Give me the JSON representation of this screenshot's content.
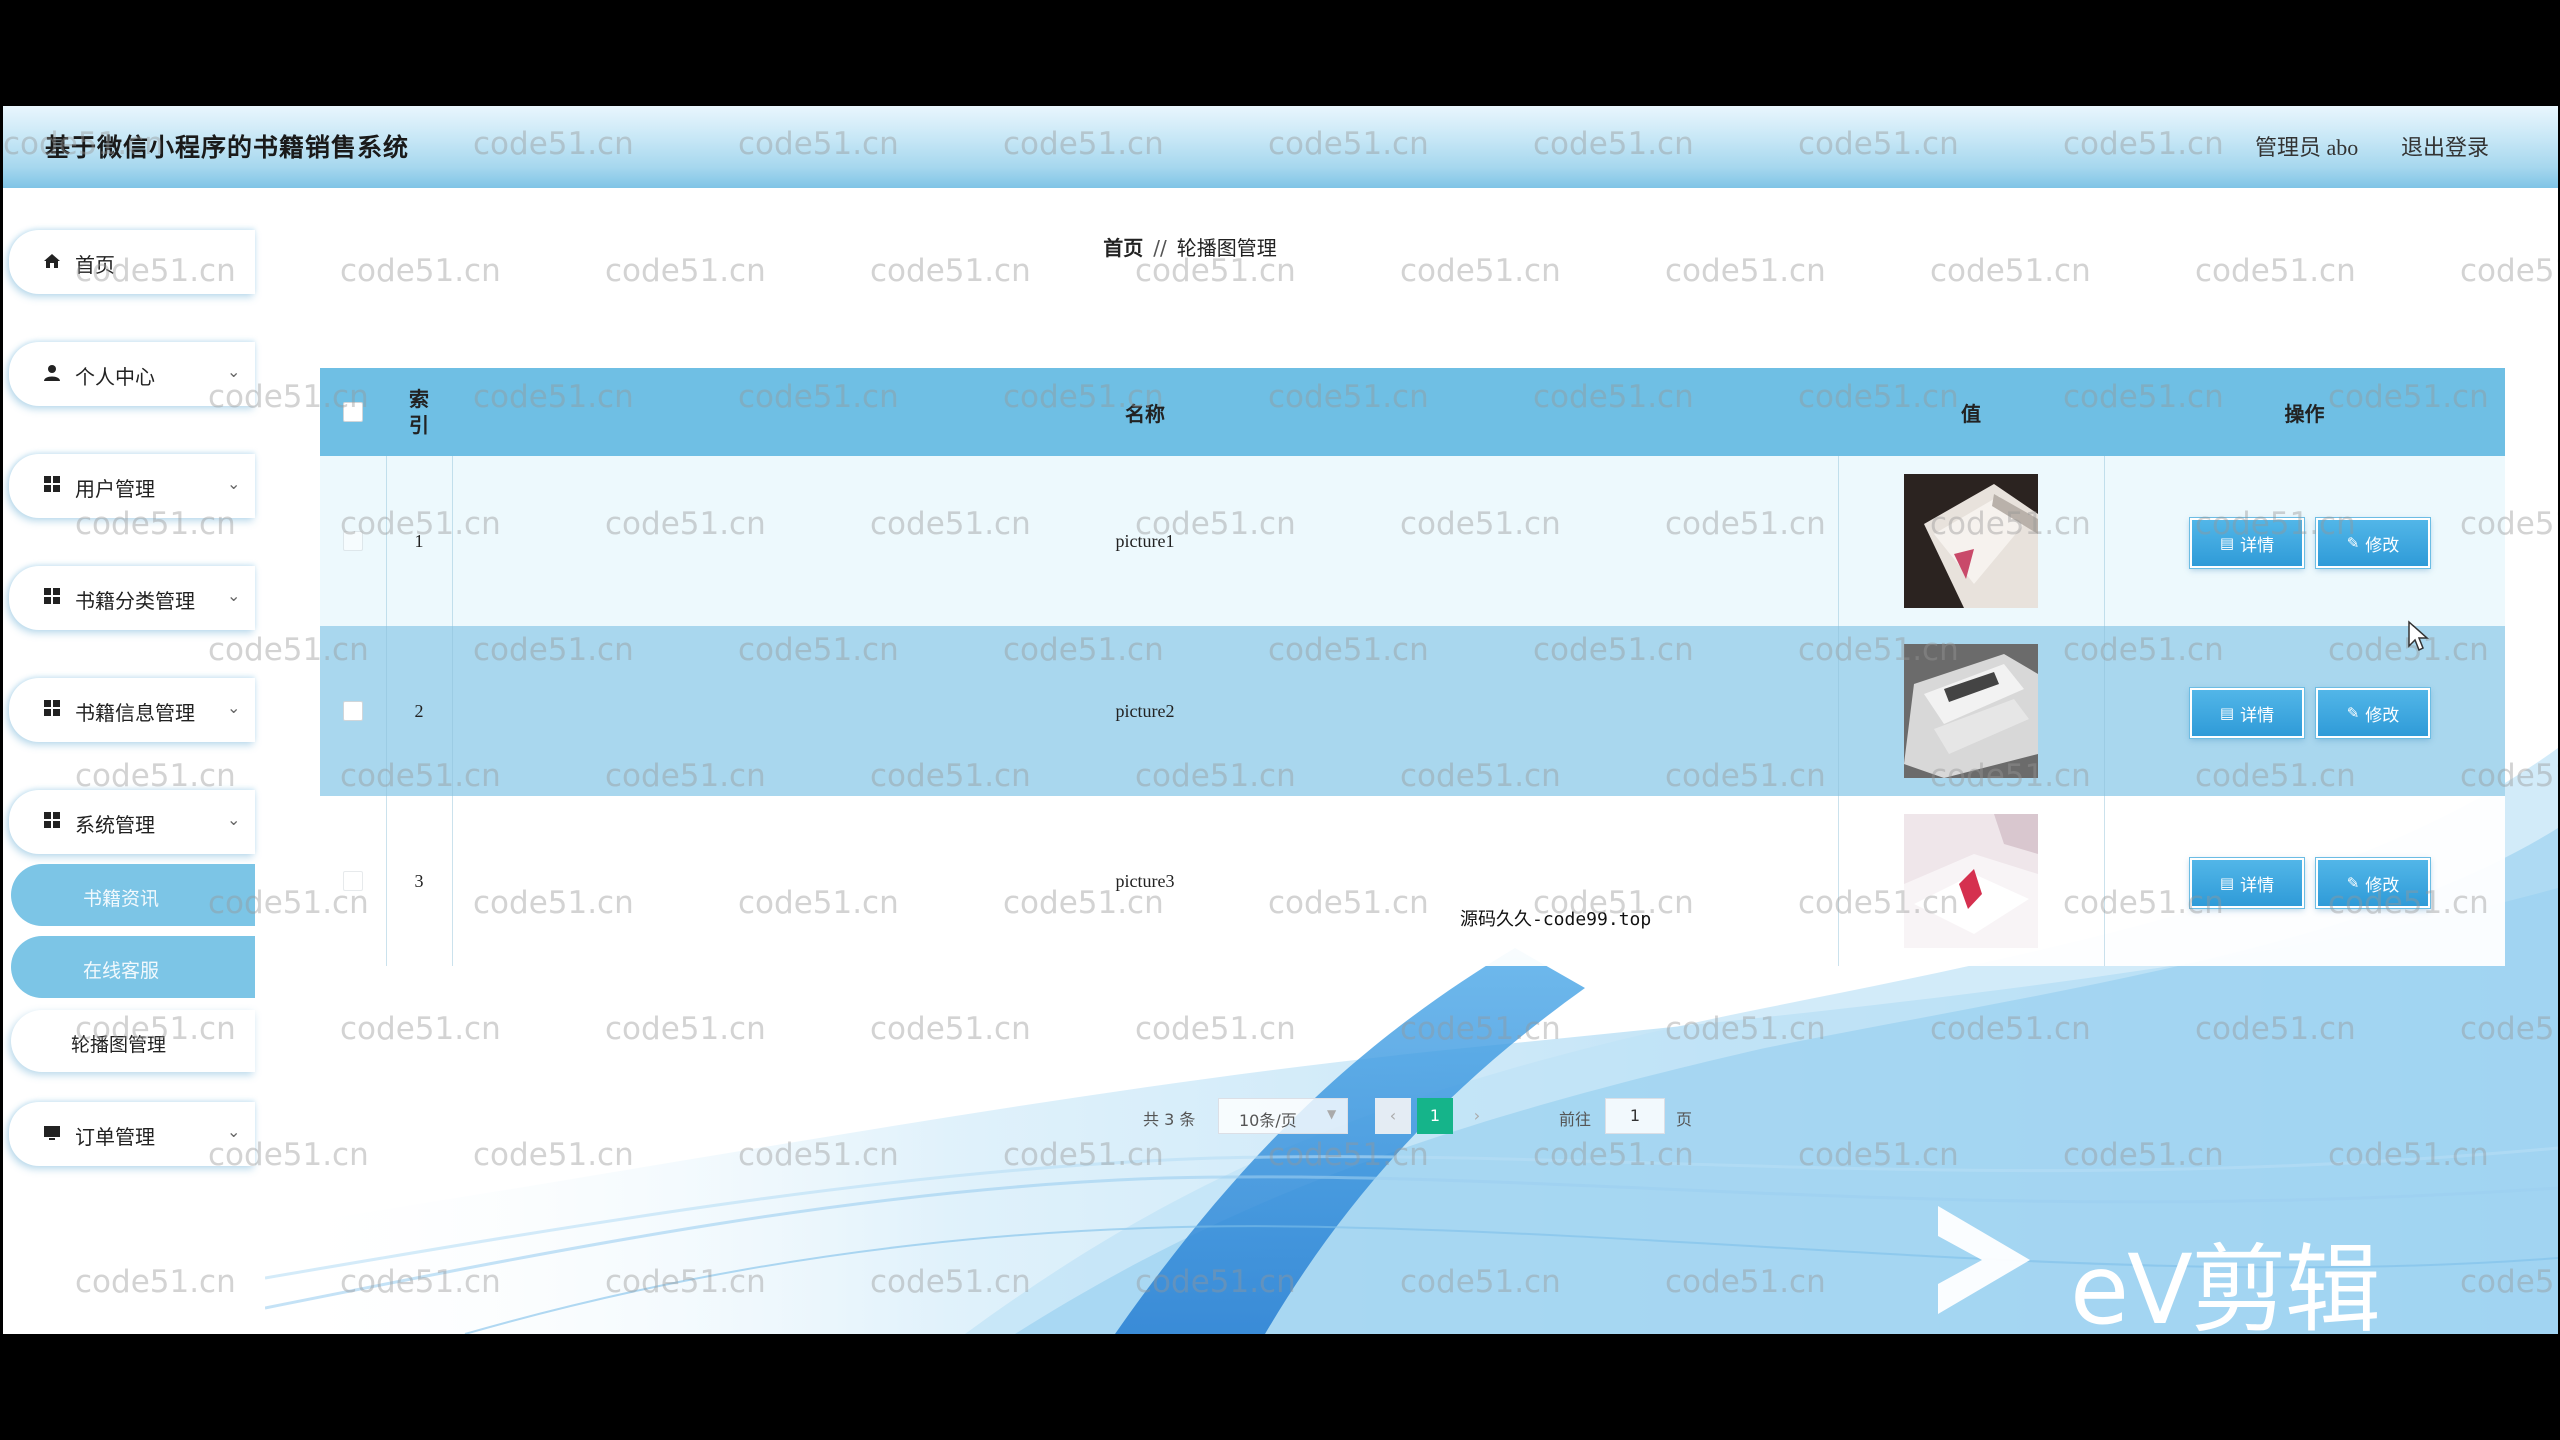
{
  "header": {
    "title": "基于微信小程序的书籍销售系统",
    "admin": "管理员 abo",
    "logout": "退出登录"
  },
  "sidebar": {
    "items": [
      {
        "label": "首页",
        "icon": "home-icon"
      },
      {
        "label": "个人中心",
        "icon": "user-icon"
      },
      {
        "label": "用户管理",
        "icon": "grid-icon"
      },
      {
        "label": "书籍分类管理",
        "icon": "grid-icon"
      },
      {
        "label": "书籍信息管理",
        "icon": "grid-icon"
      },
      {
        "label": "系统管理",
        "icon": "grid-icon"
      },
      {
        "label": "订单管理",
        "icon": "monitor-icon"
      }
    ],
    "sub_items": [
      "书籍资讯",
      "在线客服",
      "轮播图管理"
    ]
  },
  "breadcrumb": {
    "home": "首页",
    "separator": "//",
    "current": "轮播图管理"
  },
  "table": {
    "columns": [
      "索引",
      "名称",
      "值",
      "操作"
    ],
    "rows": [
      {
        "index": "1",
        "name": "picture1"
      },
      {
        "index": "2",
        "name": "picture2"
      },
      {
        "index": "3",
        "name": "picture3"
      }
    ],
    "actions": {
      "detail": "详情",
      "edit": "修改"
    }
  },
  "pagination": {
    "total": "共 3 条",
    "page_size": "10条/页",
    "current_page": "1",
    "goto_label": "前往",
    "goto_value": "1",
    "page_unit": "页"
  },
  "overlay_text": "源码久久-code99.top",
  "watermark": "code51.cn",
  "editor_logo_text": "eV剪辑",
  "colors": {
    "header_blue": "#7fc4e6",
    "table_header": "#6fbfe4",
    "button_blue": "#2f9bd8",
    "page_active": "#15b48a",
    "sidebar_active": "#7cc5e6"
  }
}
